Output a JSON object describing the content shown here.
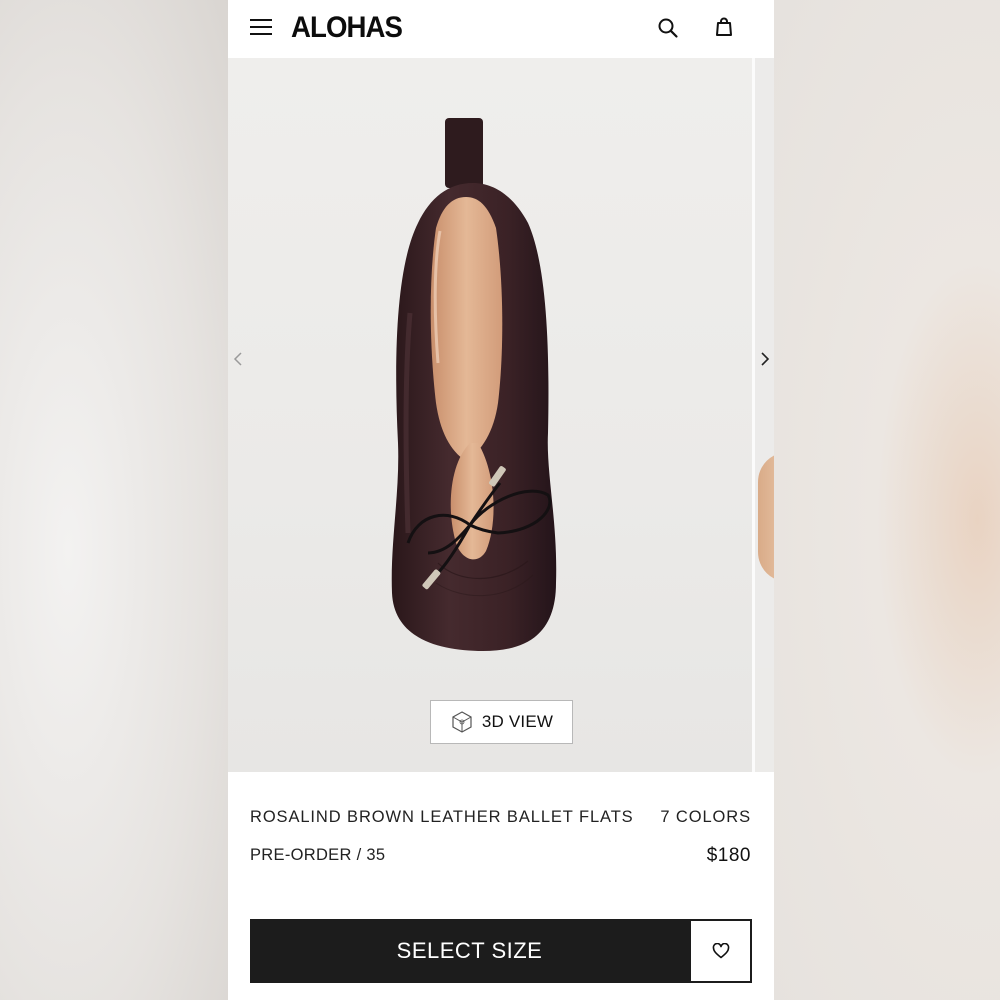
{
  "brand": {
    "logo_text": "ALOHAS"
  },
  "header": {
    "menu_icon": "hamburger-menu-icon",
    "search_icon": "search-icon",
    "bag_icon": "shopping-bag-icon"
  },
  "gallery": {
    "prev_icon": "chevron-left-icon",
    "next_icon": "chevron-right-icon",
    "view3d_label": "3D VIEW",
    "view3d_icon": "cube-icon"
  },
  "product": {
    "name": "ROSALIND BROWN LEATHER BALLET FLATS",
    "colors_label": "7 COLORS",
    "status": "PRE-ORDER / 35",
    "price": "$180"
  },
  "actions": {
    "select_size_label": "SELECT SIZE",
    "wishlist_icon": "heart-icon"
  },
  "colors": {
    "primary_button": "#1c1c1c",
    "shoe_leather": "#3a2226",
    "gallery_bg": "#ecebe9"
  }
}
